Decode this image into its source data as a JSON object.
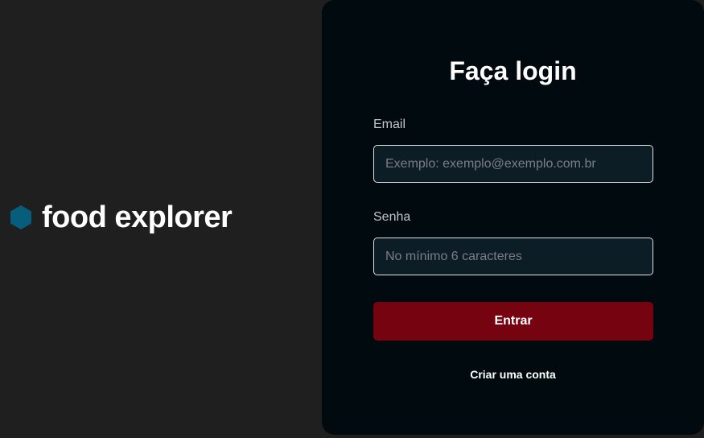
{
  "brand": {
    "name": "food explorer",
    "logo_icon": "hexagon-icon",
    "logo_color": "#065e7c"
  },
  "login": {
    "title": "Faça login",
    "email": {
      "label": "Email",
      "placeholder": "Exemplo: exemplo@exemplo.com.br",
      "value": ""
    },
    "password": {
      "label": "Senha",
      "placeholder": "No mínimo 6 caracteres",
      "value": ""
    },
    "submit_label": "Entrar",
    "create_account_label": "Criar uma conta"
  },
  "colors": {
    "background": "#1f1f1f",
    "panel": "#000a0f",
    "input_background": "#0d1d25",
    "button": "#750310"
  }
}
